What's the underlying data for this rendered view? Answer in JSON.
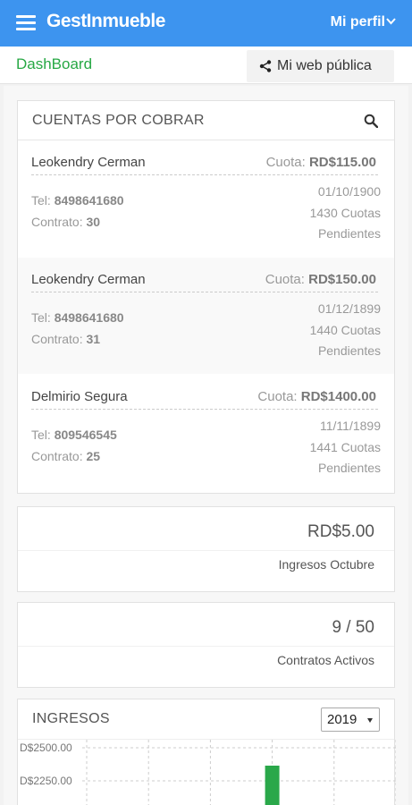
{
  "header": {
    "brand": "GestInmueble",
    "profile_label": "Mi perfil"
  },
  "subheader": {
    "title": "DashBoard",
    "web_button_label": "Mi web pública"
  },
  "accounts_card": {
    "title": "CUENTAS POR COBRAR",
    "items": [
      {
        "name": "Leokendry Cerman",
        "fee_label": "Cuota:",
        "fee": "RD$115.00",
        "tel_label": "Tel:",
        "tel": "8498641680",
        "contract_label": "Contrato:",
        "contract": "30",
        "date": "01/10/1900",
        "cuotas": "1430 Cuotas",
        "pending": "Pendientes"
      },
      {
        "name": "Leokendry Cerman",
        "fee_label": "Cuota:",
        "fee": "RD$150.00",
        "tel_label": "Tel:",
        "tel": "8498641680",
        "contract_label": "Contrato:",
        "contract": "31",
        "date": "01/12/1899",
        "cuotas": "1440 Cuotas",
        "pending": "Pendientes"
      },
      {
        "name": "Delmirio Segura",
        "fee_label": "Cuota:",
        "fee": "RD$1400.00",
        "tel_label": "Tel:",
        "tel": "809546545",
        "contract_label": "Contrato:",
        "contract": "25",
        "date": "11/11/1899",
        "cuotas": "1441 Cuotas",
        "pending": "Pendientes"
      }
    ]
  },
  "income_stat": {
    "value": "RD$5.00",
    "label": "Ingresos Octubre"
  },
  "contracts_stat": {
    "value": "9 / 50",
    "label": "Contratos Activos"
  },
  "chart_card": {
    "title": "INGRESOS",
    "year": "2019"
  },
  "colors": {
    "primary": "#3d94ef",
    "accent_green": "#27a844",
    "bar": "#2aa84a"
  },
  "chart_data": {
    "type": "bar",
    "title": "INGRESOS",
    "y_ticks": [
      "D$2500.00",
      "D$2250.00"
    ],
    "ylim": [
      2250,
      2500
    ],
    "bars": [
      {
        "category_index": 3,
        "value": 2500
      }
    ],
    "category_count": 5,
    "grid": true
  }
}
